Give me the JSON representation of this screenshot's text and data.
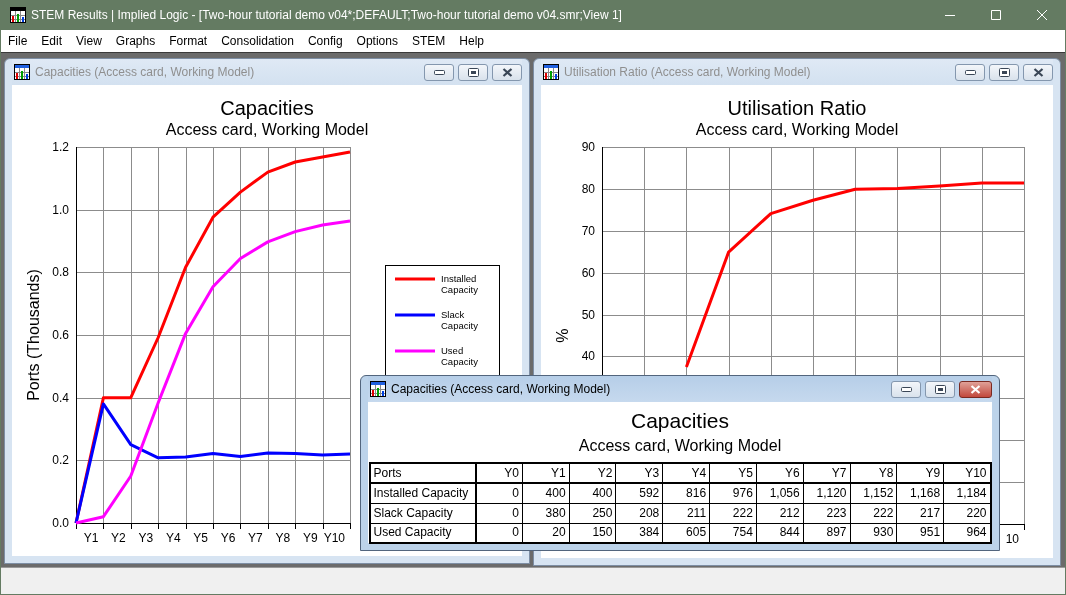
{
  "window": {
    "title": "STEM Results | Implied Logic - [Two-hour tutorial demo v04*;DEFAULT;Two-hour tutorial demo v04.smr;View 1]"
  },
  "menu": [
    "File",
    "Edit",
    "View",
    "Graphs",
    "Format",
    "Consolidation",
    "Config",
    "Options",
    "STEM",
    "Help"
  ],
  "child_windows": [
    {
      "kind": "chart",
      "title": "Capacities (Access card, Working Model)",
      "active": false,
      "subtitle": "Access card, Working Model",
      "chart_data": {
        "type": "line",
        "title": "Capacities",
        "ylabel": "Ports (Thousands)",
        "grid": true,
        "legend": true,
        "ylim": [
          0,
          1.2
        ],
        "yticks": [
          {
            "value": 0,
            "label": "0.0"
          },
          {
            "value": 0.2,
            "label": "0.2"
          },
          {
            "value": 0.4,
            "label": "0.4"
          },
          {
            "value": 0.6,
            "label": "0.6"
          },
          {
            "value": 0.8,
            "label": "0.8"
          },
          {
            "value": 1,
            "label": "1.0"
          },
          {
            "value": 1.2,
            "label": "1.2"
          }
        ],
        "series": [
          {
            "name": "Installed Capacity",
            "color": "#ff0000",
            "values": [
              0,
              0.4,
              0.4,
              0.592,
              0.816,
              0.976,
              1.056,
              1.12,
              1.152,
              1.168,
              1.184
            ]
          },
          {
            "name": "Slack Capacity",
            "color": "#0000ff",
            "values": [
              0,
              0.38,
              0.25,
              0.208,
              0.211,
              0.222,
              0.212,
              0.223,
              0.222,
              0.217,
              0.22
            ]
          },
          {
            "name": "Used Capacity",
            "color": "#ff00ff",
            "values": [
              0,
              0.02,
              0.15,
              0.384,
              0.605,
              0.754,
              0.844,
              0.897,
              0.93,
              0.951,
              0.964
            ]
          }
        ],
        "annotations": [
          "Y1",
          "Y2",
          "Y3",
          "Y4",
          "Y5",
          "Y6",
          "Y7",
          "Y8",
          "Y9",
          "Y10"
        ]
      }
    },
    {
      "kind": "chart",
      "title": "Utilisation Ratio (Access card, Working Model)",
      "active": false,
      "subtitle": "Access card, Working Model",
      "chart_data": {
        "type": "line",
        "title": "Utilisation Ratio",
        "ylabel": "%",
        "grid": true,
        "ylim": [
          0,
          90
        ],
        "yticks": [
          {
            "value": 40,
            "label": "40"
          },
          {
            "value": 50,
            "label": "50"
          },
          {
            "value": 60,
            "label": "60"
          },
          {
            "value": 70,
            "label": "70"
          },
          {
            "value": 80,
            "label": "80"
          },
          {
            "value": 90,
            "label": "90"
          }
        ],
        "series": [
          {
            "color": "#ff0000",
            "values": [
              null,
              null,
              37.5,
              64.9,
              74.1,
              77.3,
              79.9,
              80.1,
              80.7,
              81.4,
              81.4
            ]
          }
        ],
        "annotations": [
          "10"
        ]
      }
    },
    {
      "kind": "table",
      "title": "Capacities (Access card, Working Model)",
      "active": true,
      "heading": "Capacities",
      "subtitle": "Access card, Working Model",
      "table": {
        "columns": [
          "Ports",
          "Y0",
          "Y1",
          "Y2",
          "Y3",
          "Y4",
          "Y5",
          "Y6",
          "Y7",
          "Y8",
          "Y9",
          "Y10"
        ],
        "rows": [
          [
            "Installed Capacity",
            "0",
            "400",
            "400",
            "592",
            "816",
            "976",
            "1,056",
            "1,120",
            "1,152",
            "1,168",
            "1,184"
          ],
          [
            "Slack Capacity",
            "0",
            "380",
            "250",
            "208",
            "211",
            "222",
            "212",
            "223",
            "222",
            "217",
            "220"
          ],
          [
            "Used Capacity",
            "0",
            "20",
            "150",
            "384",
            "605",
            "754",
            "844",
            "897",
            "930",
            "951",
            "964"
          ]
        ]
      }
    }
  ]
}
